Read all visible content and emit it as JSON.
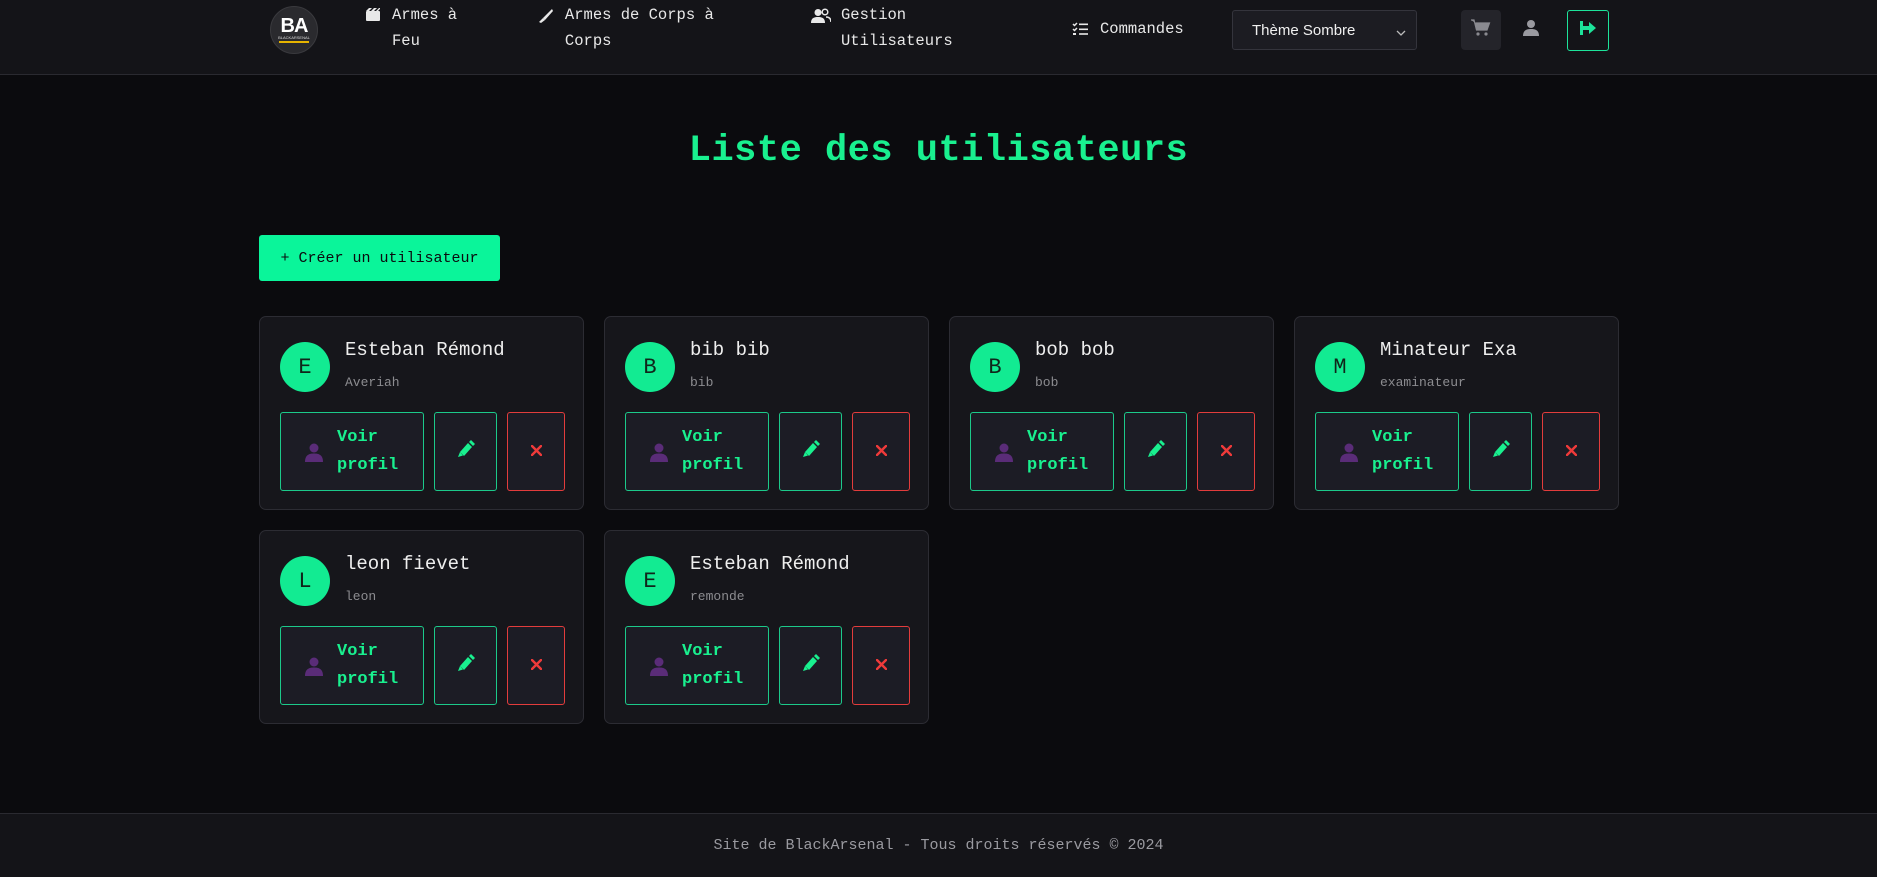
{
  "nav": {
    "logo": {
      "mark": "BA",
      "sub": "BLACKARSENAL"
    },
    "items": [
      {
        "label": "Armes à Feu",
        "icon": "film-icon"
      },
      {
        "label": "Armes de Corps à Corps",
        "icon": "knife-icon"
      },
      {
        "label": "Gestion Utilisateurs",
        "icon": "users-icon"
      },
      {
        "label": "Commandes",
        "icon": "checklist-icon"
      }
    ],
    "theme_select": {
      "value": "Thème Sombre"
    },
    "icons": {
      "cart": "cart-icon",
      "user": "user-icon",
      "logout": "logout-icon"
    }
  },
  "main": {
    "title": "Liste des utilisateurs",
    "create_button": "+ Créer un utilisateur",
    "users": [
      {
        "initial": "E",
        "name": "Esteban Rémond",
        "login": "Averiah"
      },
      {
        "initial": "B",
        "name": "bib bib",
        "login": "bib"
      },
      {
        "initial": "B",
        "name": "bob bob",
        "login": "bob"
      },
      {
        "initial": "M",
        "name": "Minateur Exa",
        "login": "examinateur"
      },
      {
        "initial": "L",
        "name": "leon fievet",
        "login": "leon"
      },
      {
        "initial": "E",
        "name": "Esteban Rémond",
        "login": "remonde"
      }
    ],
    "card_actions": {
      "view_profile": "Voir profil",
      "view_line1": "Voir",
      "view_line2": "profil"
    }
  },
  "footer": {
    "text": "Site de BlackArsenal - Tous droits réservés © 2024"
  },
  "colors": {
    "accent": "#19f08f",
    "danger": "#e23c3c",
    "background": "#0b0b0e",
    "panel": "#16161b"
  }
}
